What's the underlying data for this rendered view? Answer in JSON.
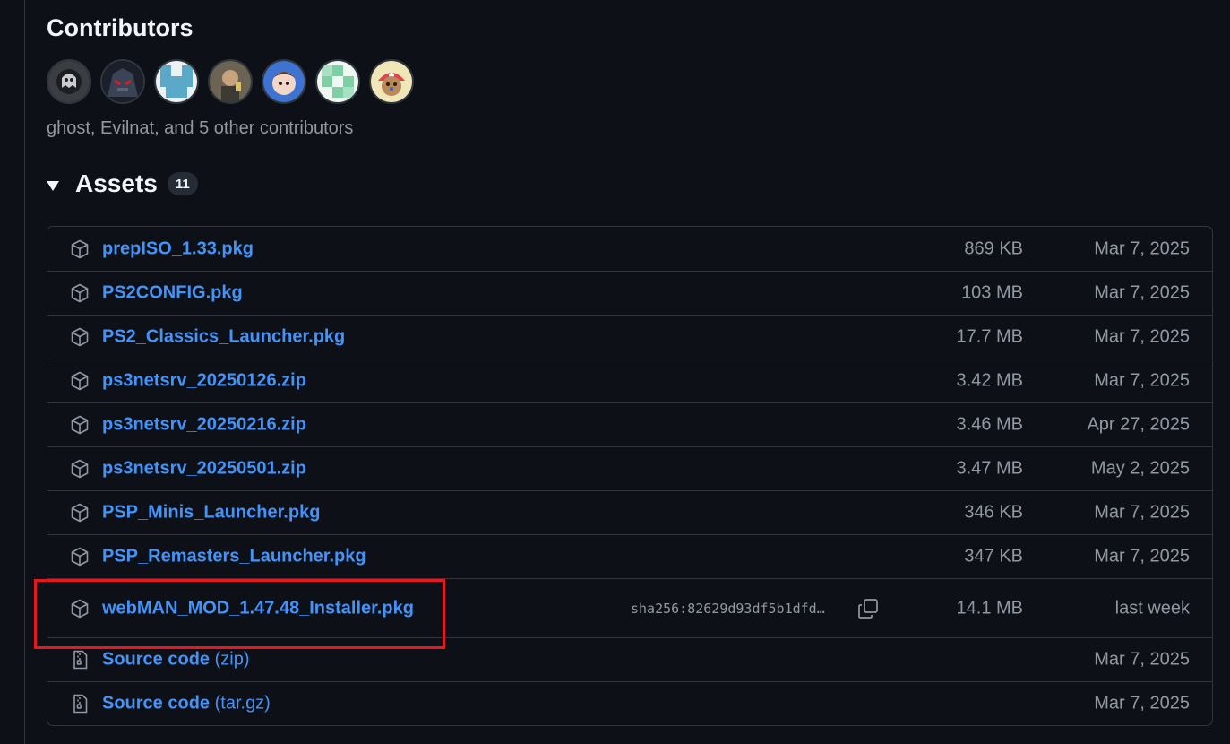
{
  "contributors": {
    "heading": "Contributors",
    "summary": "ghost, Evilnat, and 5 other contributors",
    "avatars": [
      {
        "name": "ghost"
      },
      {
        "name": "Evilnat"
      },
      {
        "name": "contributor-3"
      },
      {
        "name": "contributor-4"
      },
      {
        "name": "contributor-5"
      },
      {
        "name": "contributor-6"
      },
      {
        "name": "contributor-7"
      }
    ]
  },
  "assets": {
    "heading": "Assets",
    "count": "11",
    "items": [
      {
        "name": "prepISO_1.33.pkg",
        "size": "869 KB",
        "date": "Mar 7, 2025",
        "icon": "package-icon"
      },
      {
        "name": "PS2CONFIG.pkg",
        "size": "103 MB",
        "date": "Mar 7, 2025",
        "icon": "package-icon"
      },
      {
        "name": "PS2_Classics_Launcher.pkg",
        "size": "17.7 MB",
        "date": "Mar 7, 2025",
        "icon": "package-icon"
      },
      {
        "name": "ps3netsrv_20250126.zip",
        "size": "3.42 MB",
        "date": "Mar 7, 2025",
        "icon": "package-icon"
      },
      {
        "name": "ps3netsrv_20250216.zip",
        "size": "3.46 MB",
        "date": "Apr 27, 2025",
        "icon": "package-icon"
      },
      {
        "name": "ps3netsrv_20250501.zip",
        "size": "3.47 MB",
        "date": "May 2, 2025",
        "icon": "package-icon"
      },
      {
        "name": "PSP_Minis_Launcher.pkg",
        "size": "346 KB",
        "date": "Mar 7, 2025",
        "icon": "package-icon"
      },
      {
        "name": "PSP_Remasters_Launcher.pkg",
        "size": "347 KB",
        "date": "Mar 7, 2025",
        "icon": "package-icon"
      },
      {
        "name": "webMAN_MOD_1.47.48_Installer.pkg",
        "sha": "sha256:82629d93df5b1dfd…",
        "size": "14.1 MB",
        "date": "last week",
        "icon": "package-icon"
      },
      {
        "name": "Source code",
        "suffix": "(zip)",
        "size": "",
        "date": "Mar 7, 2025",
        "icon": "file-zip-icon"
      },
      {
        "name": "Source code",
        "suffix": "(tar.gz)",
        "size": "",
        "date": "Mar 7, 2025",
        "icon": "file-zip-icon"
      }
    ]
  },
  "colors": {
    "background": "#0d1117",
    "link": "#4493f8",
    "muted": "#9198a1",
    "border": "#30363d",
    "highlight": "#e5191f"
  }
}
